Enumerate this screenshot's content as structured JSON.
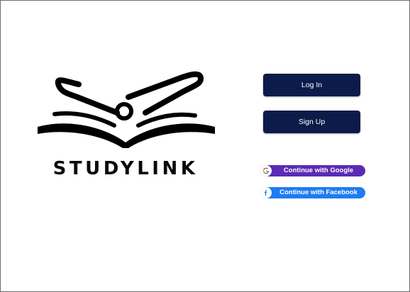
{
  "brand": {
    "name": "STUDYLINK"
  },
  "auth": {
    "login_label": "Log In",
    "signup_label": "Sign Up",
    "google_label": "Continue with Google",
    "facebook_label": "Continue with Facebook"
  },
  "colors": {
    "primary_button": "#0d1b4a",
    "google_button": "#5b2bb5",
    "facebook_button": "#1f7cf2",
    "logo": "#000000"
  },
  "icons": {
    "logo": "book-link-logo-icon",
    "google": "google-icon",
    "facebook": "facebook-icon"
  }
}
